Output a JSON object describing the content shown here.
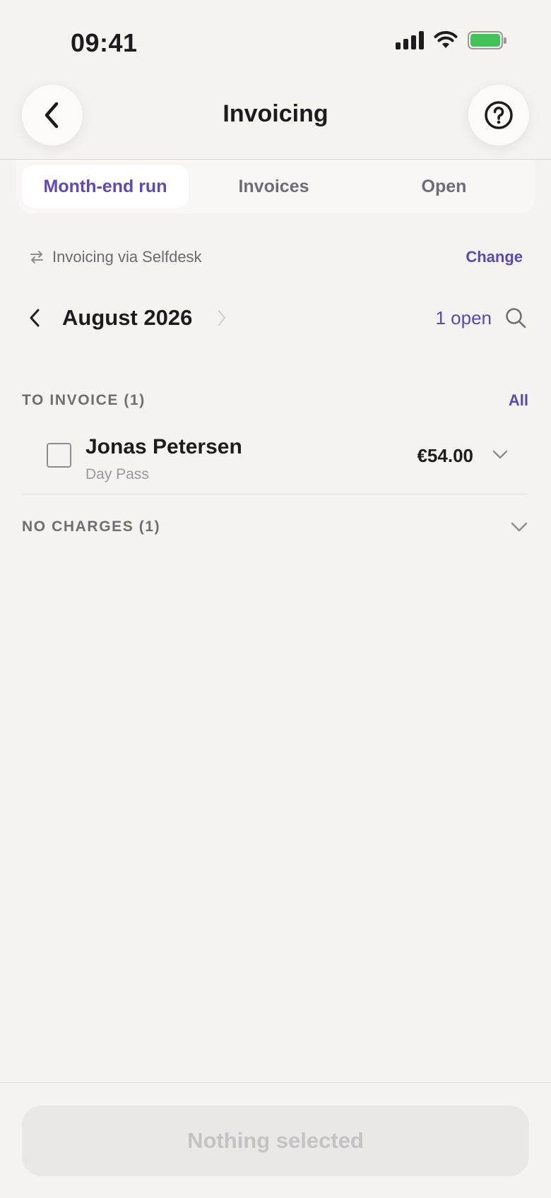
{
  "status_bar": {
    "time": "09:41"
  },
  "nav": {
    "title": "Invoicing"
  },
  "tabs": [
    {
      "label": "Month-end run",
      "active": true
    },
    {
      "label": "Invoices",
      "active": false
    },
    {
      "label": "Open",
      "active": false
    }
  ],
  "provider": {
    "text": "Invoicing via Selfdesk",
    "action": "Change"
  },
  "period": {
    "month": "August 2026",
    "open_count": "1 open"
  },
  "sections": {
    "to_invoice": {
      "label": "TO INVOICE (1)",
      "action": "All",
      "rows": [
        {
          "name": "Jonas Petersen",
          "subtitle": "Day Pass",
          "amount": "€54.00",
          "checked": false
        }
      ]
    },
    "no_charges": {
      "label": "NO CHARGES (1)"
    }
  },
  "footer": {
    "button_label": "Nothing selected"
  },
  "colors": {
    "accent": "#5c47b5",
    "background": "#f4f3f0",
    "battery": "#43c25a"
  }
}
